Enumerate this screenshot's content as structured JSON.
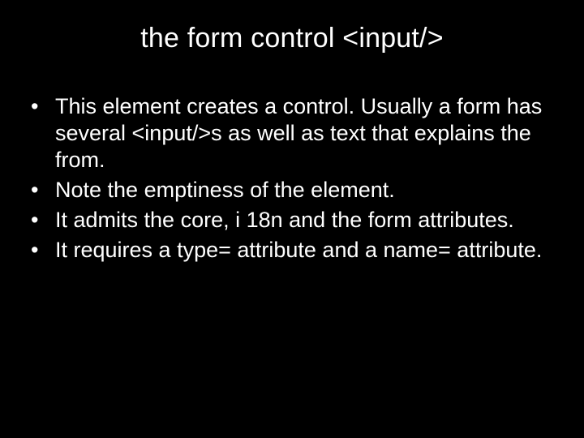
{
  "title": "the form control <input/>",
  "bullets": [
    "This element creates a control. Usually a form has several <input/>s as well as text that explains the from.",
    "Note the emptiness of the element.",
    "It admits the core, i 18n and the form attributes.",
    "It requires a type= attribute and a name= attribute."
  ]
}
